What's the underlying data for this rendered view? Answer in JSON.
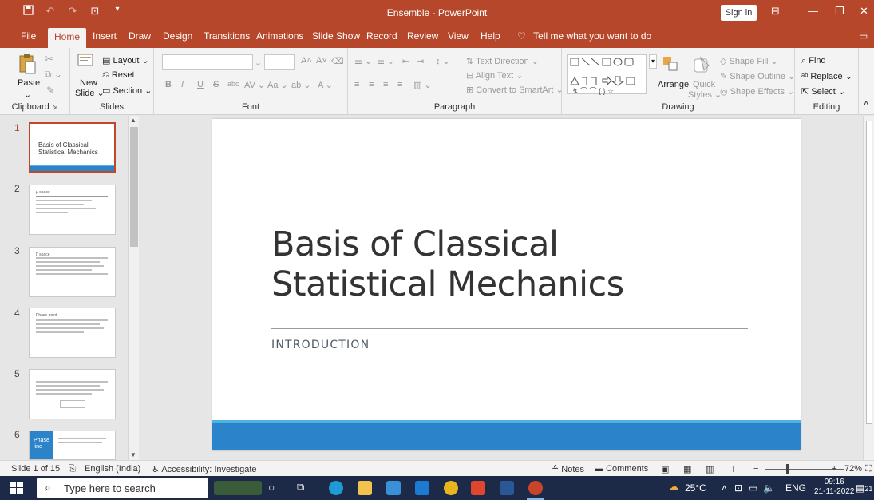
{
  "window": {
    "title": "Ensemble - PowerPoint",
    "sign_in_label": "Sign in",
    "accent_color": "#b7472a"
  },
  "menu": {
    "tabs": [
      "File",
      "Home",
      "Insert",
      "Draw",
      "Design",
      "Transitions",
      "Animations",
      "Slide Show",
      "Record",
      "Review",
      "View",
      "Help"
    ],
    "active_tab": "Home",
    "tell_me": "Tell me what you want to do"
  },
  "ribbon": {
    "clipboard": {
      "paste": "Paste",
      "label": "Clipboard"
    },
    "slides": {
      "new_slide_line1": "New",
      "new_slide_line2": "Slide",
      "layout": "Layout",
      "reset": "Reset",
      "section": "Section",
      "label": "Slides"
    },
    "font": {
      "label": "Font",
      "bold": "B",
      "italic": "I",
      "underline": "U",
      "strike": "S",
      "abc": "abc",
      "av": "AV",
      "aa": "Aa",
      "grow": "A",
      "shrink": "A"
    },
    "paragraph": {
      "text_direction": "Text Direction",
      "align_text": "Align Text",
      "convert_smartart": "Convert to SmartArt",
      "label": "Paragraph"
    },
    "drawing": {
      "arrange": "Arrange",
      "quick_styles_line1": "Quick",
      "quick_styles_line2": "Styles",
      "shape_fill": "Shape Fill",
      "shape_outline": "Shape Outline",
      "shape_effects": "Shape Effects",
      "label": "Drawing"
    },
    "editing": {
      "find": "Find",
      "replace": "Replace",
      "select": "Select",
      "label": "Editing"
    }
  },
  "thumbnails": [
    {
      "number": "1",
      "title_line1": "Basis of Classical",
      "title_line2": "Statistical Mechanics",
      "active": true
    },
    {
      "number": "2",
      "heading": "μ space"
    },
    {
      "number": "3",
      "heading": "Γ space"
    },
    {
      "number": "4",
      "heading": "Phase point"
    },
    {
      "number": "5"
    },
    {
      "number": "6",
      "title_line1": "Phase",
      "title_line2": "line"
    }
  ],
  "slide": {
    "title_line1": "Basis of Classical",
    "title_line2": "Statistical Mechanics",
    "subtitle": "INTRODUCTION",
    "bar_color": "#2b84c9"
  },
  "status": {
    "slide_info": "Slide 1 of 15",
    "language": "English (India)",
    "accessibility": "Accessibility: Investigate",
    "notes": "Notes",
    "comments": "Comments",
    "zoom": "72%"
  },
  "taskbar": {
    "search_placeholder": "Type here to search",
    "weather": "25°C",
    "lang": "ENG",
    "time": "09:16",
    "date": "21-11-2022",
    "notification_count": "21"
  }
}
